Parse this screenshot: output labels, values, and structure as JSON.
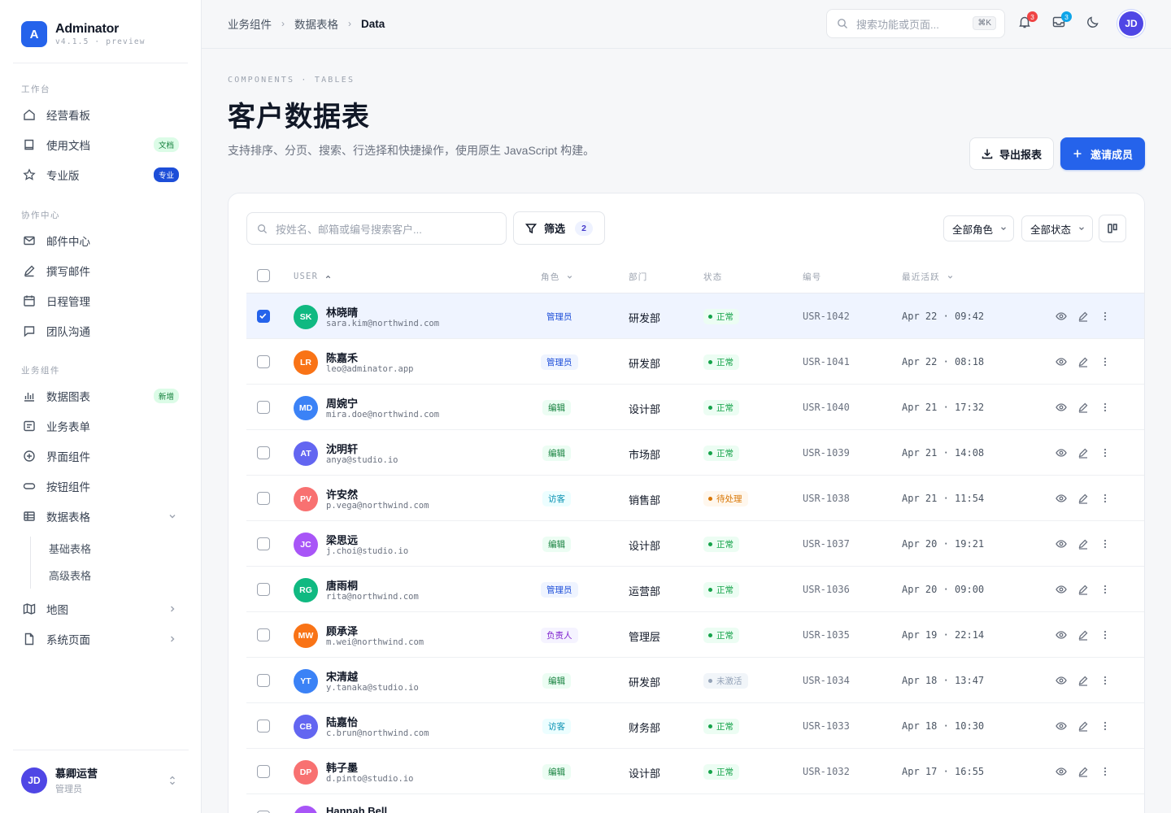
{
  "app": {
    "name": "Adminator",
    "version": "v4.1.5 · preview",
    "logo_letter": "A"
  },
  "sidebar": {
    "sections": [
      {
        "title": "工作台"
      },
      {
        "title": "协作中心"
      },
      {
        "title": "业务组件"
      }
    ],
    "items": [
      {
        "label": "经营看板",
        "icon": "home-icon"
      },
      {
        "label": "使用文档",
        "icon": "book-icon",
        "badge": "文档"
      },
      {
        "label": "专业版",
        "icon": "star-icon",
        "badge": "专业"
      },
      {
        "label": "邮件中心",
        "icon": "mail-icon"
      },
      {
        "label": "撰写邮件",
        "icon": "pencil-icon"
      },
      {
        "label": "日程管理",
        "icon": "calendar-icon"
      },
      {
        "label": "团队沟通",
        "icon": "chat-icon"
      },
      {
        "label": "数据图表",
        "icon": "bar-chart-icon",
        "badge": "新增"
      },
      {
        "label": "业务表单",
        "icon": "form-icon"
      },
      {
        "label": "界面组件",
        "icon": "plus-circle-icon"
      },
      {
        "label": "按钮组件",
        "icon": "button-icon"
      },
      {
        "label": "数据表格",
        "icon": "table-icon",
        "expanded": true
      },
      {
        "label": "地图",
        "icon": "map-icon"
      },
      {
        "label": "系统页面",
        "icon": "file-icon"
      }
    ],
    "subitems": [
      {
        "label": "基础表格"
      },
      {
        "label": "高级表格"
      }
    ],
    "user": {
      "initials": "JD",
      "name": "慕卿运营",
      "role": "管理员"
    }
  },
  "topbar": {
    "breadcrumbs": [
      "业务组件",
      "数据表格",
      "Data"
    ],
    "search_placeholder": "搜索功能或页面...",
    "search_shortcut": "⌘K",
    "notifications_count": "3",
    "messages_count": "3",
    "avatar_initials": "JD"
  },
  "header": {
    "eyebrow": "COMPONENTS · TABLES",
    "title": "客户数据表",
    "description": "支持排序、分页、搜索、行选择和快捷操作，使用原生 JavaScript 构建。",
    "export_label": "导出报表",
    "invite_label": "邀请成员"
  },
  "table": {
    "search_placeholder": "按姓名、邮箱或编号搜索客户...",
    "filter_label": "筛选",
    "filter_count": "2",
    "role_select": "全部角色",
    "status_select": "全部状态",
    "columns": {
      "user": "USER",
      "role": "角色",
      "dept": "部门",
      "status": "状态",
      "id": "编号",
      "last_active": "最近活跃"
    },
    "rows": [
      {
        "initials": "SK",
        "color": "#10b981",
        "name": "林晓晴",
        "email": "sara.kim@northwind.com",
        "role": "管理员",
        "dept": "研发部",
        "status": "正常",
        "id": "USR-1042",
        "time": "Apr 22 · 09:42",
        "selected": true
      },
      {
        "initials": "LR",
        "color": "#f97316",
        "name": "陈嘉禾",
        "email": "leo@adminator.app",
        "role": "管理员",
        "dept": "研发部",
        "status": "正常",
        "id": "USR-1041",
        "time": "Apr 22 · 08:18"
      },
      {
        "initials": "MD",
        "color": "#3b82f6",
        "name": "周婉宁",
        "email": "mira.doe@northwind.com",
        "role": "编辑",
        "dept": "设计部",
        "status": "正常",
        "id": "USR-1040",
        "time": "Apr 21 · 17:32"
      },
      {
        "initials": "AT",
        "color": "#6366f1",
        "name": "沈明轩",
        "email": "anya@studio.io",
        "role": "编辑",
        "dept": "市场部",
        "status": "正常",
        "id": "USR-1039",
        "time": "Apr 21 · 14:08"
      },
      {
        "initials": "PV",
        "color": "#f87171",
        "name": "许安然",
        "email": "p.vega@northwind.com",
        "role": "访客",
        "dept": "销售部",
        "status": "待处理",
        "id": "USR-1038",
        "time": "Apr 21 · 11:54"
      },
      {
        "initials": "JC",
        "color": "#a855f7",
        "name": "梁思远",
        "email": "j.choi@studio.io",
        "role": "编辑",
        "dept": "设计部",
        "status": "正常",
        "id": "USR-1037",
        "time": "Apr 20 · 19:21"
      },
      {
        "initials": "RG",
        "color": "#10b981",
        "name": "唐雨桐",
        "email": "rita@northwind.com",
        "role": "管理员",
        "dept": "运营部",
        "status": "正常",
        "id": "USR-1036",
        "time": "Apr 20 · 09:00"
      },
      {
        "initials": "MW",
        "color": "#f97316",
        "name": "顾承泽",
        "email": "m.wei@northwind.com",
        "role": "负责人",
        "dept": "管理层",
        "status": "正常",
        "id": "USR-1035",
        "time": "Apr 19 · 22:14"
      },
      {
        "initials": "YT",
        "color": "#3b82f6",
        "name": "宋清越",
        "email": "y.tanaka@studio.io",
        "role": "编辑",
        "dept": "研发部",
        "status": "未激活",
        "id": "USR-1034",
        "time": "Apr 18 · 13:47"
      },
      {
        "initials": "CB",
        "color": "#6366f1",
        "name": "陆嘉怡",
        "email": "c.brun@northwind.com",
        "role": "访客",
        "dept": "财务部",
        "status": "正常",
        "id": "USR-1033",
        "time": "Apr 18 · 10:30"
      },
      {
        "initials": "DP",
        "color": "#f87171",
        "name": "韩子墨",
        "email": "d.pinto@studio.io",
        "role": "编辑",
        "dept": "设计部",
        "status": "正常",
        "id": "USR-1032",
        "time": "Apr 17 · 16:55"
      },
      {
        "initials": "",
        "color": "#a855f7",
        "name": "Hannah Bell",
        "email": "",
        "role": "",
        "dept": "",
        "status": "",
        "id": "",
        "time": ""
      }
    ]
  },
  "colors": {
    "accent": "#2563eb",
    "role_admin": "#1d4ed8",
    "role_editor": "#15803d",
    "role_guest": "#0891b2",
    "role_owner": "#7e22ce",
    "status_ok": "#16a34a",
    "status_pending": "#d97706",
    "status_inactive": "#94a3b8"
  }
}
